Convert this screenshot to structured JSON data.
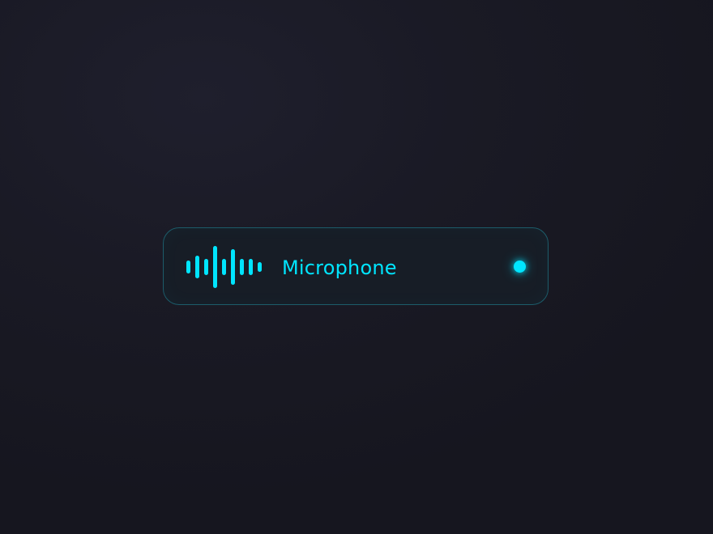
{
  "microphone": {
    "label": "Microphone",
    "accent_color": "#00e5ff",
    "icon": "waveform-icon",
    "status": "active"
  }
}
